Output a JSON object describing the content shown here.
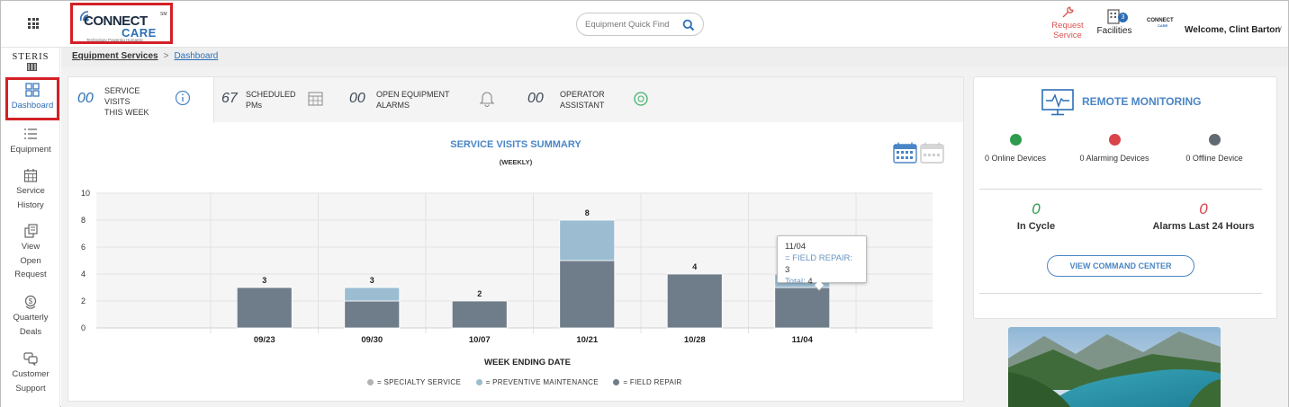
{
  "header": {
    "logo": {
      "wordmark_top": "CONNECT",
      "wordmark_bottom": "CARE",
      "trademark": "SM",
      "tagline": "Technology Powering Humanity",
      "icon": "connectcare-wifi-icon"
    },
    "search": {
      "placeholder": "Equipment Quick Find",
      "icon": "search-icon"
    },
    "request_service": {
      "line1": "Request",
      "line2": "Service",
      "icon": "wrench-icon"
    },
    "facilities": {
      "label": "Facilities",
      "badge": "3",
      "icon": "building-icon"
    },
    "mini_logo": {
      "top": "CONNECT",
      "bottom": "CARE"
    },
    "welcome": "Welcome, Clint Barton",
    "colors": {
      "accent": "#2c6fb5",
      "alert": "#d9534f",
      "highlight_box": "#d32027"
    }
  },
  "sidebar": {
    "brand": "STERIS",
    "items": [
      {
        "line1": "Dashboard",
        "line2": "",
        "line3": "",
        "icon": "dashboard-icon",
        "active": true
      },
      {
        "line1": "Equipment",
        "line2": "",
        "line3": "",
        "icon": "list-icon"
      },
      {
        "line1": "Service",
        "line2": "History",
        "line3": "",
        "icon": "calendar-icon"
      },
      {
        "line1": "View",
        "line2": "Open",
        "line3": "Request",
        "icon": "open-request-icon"
      },
      {
        "line1": "Quarterly",
        "line2": "Deals",
        "line3": "",
        "icon": "deals-icon"
      },
      {
        "line1": "Customer",
        "line2": "Support",
        "line3": "",
        "icon": "chat-support-icon"
      }
    ]
  },
  "breadcrumb": {
    "root": "Equipment Services",
    "separator": ">",
    "current": "Dashboard"
  },
  "tabs": [
    {
      "count": "00",
      "line1": "SERVICE",
      "line2": "VISITS",
      "line3": "THIS WEEK",
      "icon": "info-icon"
    },
    {
      "count": "67",
      "line1": "SCHEDULED",
      "line2": "PMs",
      "line3": "",
      "icon": "calendar-grid-icon"
    },
    {
      "count": "00",
      "line1": "OPEN EQUIPMENT",
      "line2": "ALARMS",
      "line3": "",
      "icon": "bell-icon"
    },
    {
      "count": "00",
      "line1": "OPERATOR",
      "line2": "ASSISTANT",
      "line3": "",
      "icon": "operator-assistant-icon"
    }
  ],
  "chart_data": {
    "type": "bar",
    "stacked": true,
    "title": "SERVICE VISITS SUMMARY",
    "subtitle": "(WEEKLY)",
    "xlabel": "WEEK ENDING DATE",
    "ylabel": "",
    "ylim": [
      0,
      10
    ],
    "yticks": [
      0,
      2,
      4,
      6,
      8,
      10
    ],
    "categories": [
      "09/23",
      "09/30",
      "10/07",
      "10/21",
      "10/28",
      "11/04"
    ],
    "series": [
      {
        "name": "SPECIALTY SERVICE",
        "color": "#b3b3b3",
        "values": [
          0,
          0,
          0,
          0,
          0,
          0
        ]
      },
      {
        "name": "FIELD REPAIR",
        "color": "#6f7c89",
        "values": [
          3,
          2,
          2,
          5,
          4,
          3
        ]
      },
      {
        "name": "PREVENTIVE MAINTENANCE",
        "color": "#9cbdd1",
        "values": [
          0,
          1,
          0,
          3,
          0,
          1
        ]
      }
    ],
    "legend_order": [
      "SPECIALTY SERVICE",
      "PREVENTIVE MAINTENANCE",
      "FIELD REPAIR"
    ],
    "legend_prefix": "=",
    "totals": [
      3,
      3,
      2,
      8,
      4,
      4
    ],
    "grid": true,
    "legend_position": "bottom"
  },
  "tooltip": {
    "date": "11/04",
    "series_label": "= FIELD REPAIR:",
    "series_value": "3",
    "total_label": "Total:",
    "total_value": "4"
  },
  "remote_monitoring": {
    "title": "REMOTE MONITORING",
    "icon": "monitor-pulse-icon",
    "devices": [
      {
        "label": "0 Online Devices",
        "color": "#2e9b4e"
      },
      {
        "label": "0 Alarming Devices",
        "color": "#d9434a"
      },
      {
        "label": "0 Offline Device",
        "color": "#616a73"
      }
    ],
    "in_cycle": {
      "value": "0",
      "label": "In Cycle",
      "color": "#2e9b4e"
    },
    "alarms_24h": {
      "value": "0",
      "label": "Alarms Last 24 Hours",
      "color": "#d9434a"
    },
    "command_center": "VIEW COMMAND CENTER"
  }
}
